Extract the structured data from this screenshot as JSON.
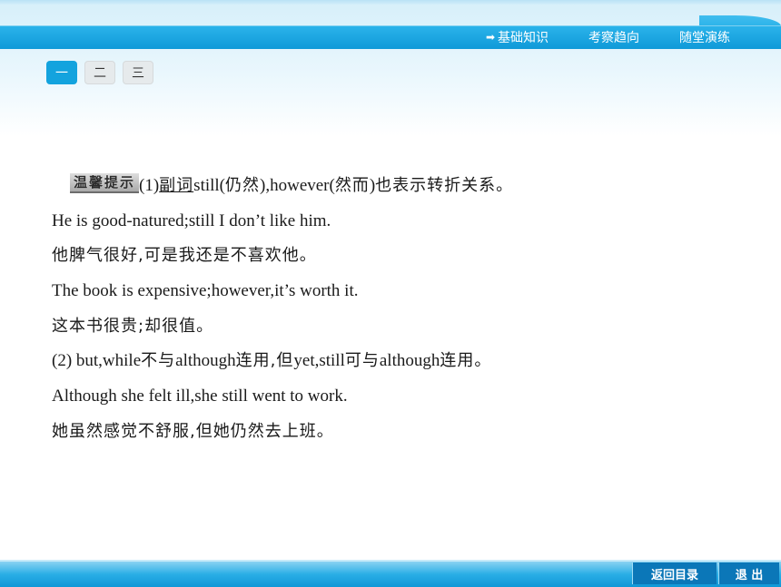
{
  "nav": {
    "links": [
      {
        "icon": "arrow-right-icon",
        "label": "基础知识"
      },
      {
        "label": "考察趋向"
      },
      {
        "label": "随堂演练"
      }
    ]
  },
  "tabs": [
    {
      "label": "一",
      "active": true
    },
    {
      "label": "二",
      "active": false
    },
    {
      "label": "三",
      "active": false
    }
  ],
  "content": {
    "tip_badge": "温馨提示",
    "line1_prefix": "(1)",
    "line1_term": "副词",
    "line1_still": "still(",
    "line1_reng": "仍然",
    "line1_however": "),however(",
    "line1_ran": "然而",
    "line1_end_paren": ")",
    "line1_tail": "也表示转折关系。",
    "ex1_en": "He is good-natured;still I don’t like him.",
    "ex1_cn": "他脾气很好,可是我还是不喜欢他。",
    "ex2_en": "The book is expensive;however,it’s worth it.",
    "ex2_cn": "这本书很贵;却很值。",
    "line2_a": "(2) but,while",
    "line2_b": "不与",
    "line2_c": "although",
    "line2_d": "连用,但",
    "line2_e": "yet,still",
    "line2_f": "可与",
    "line2_g": "although",
    "line2_h": "连用。",
    "ex3_en": "Although she felt ill,she still went to work.",
    "ex3_cn": "她虽然感觉不舒服,但她仍然去上班。"
  },
  "footer": {
    "back_label": "返回目录",
    "exit_label": "退 出"
  },
  "colors": {
    "accent": "#13a3de",
    "nav_bar": "#0f9ad8",
    "footer_button": "#0b77b8"
  }
}
